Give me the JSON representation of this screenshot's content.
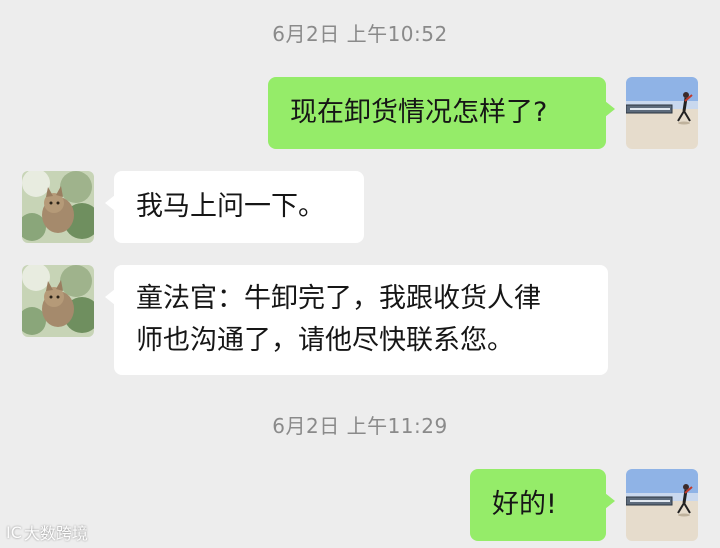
{
  "chat": {
    "timestamps": [
      "6月2日 上午10:52",
      "6月2日 上午11:29"
    ],
    "messages": [
      {
        "direction": "outgoing",
        "text": "现在卸货情况怎样了?"
      },
      {
        "direction": "incoming",
        "text": "我马上问一下。"
      },
      {
        "direction": "incoming",
        "lines": [
          "童法官：牛卸完了，我跟收货人律",
          "师也沟通了，请他尽快联系您。"
        ]
      },
      {
        "direction": "outgoing",
        "text": "好的!"
      }
    ]
  },
  "avatars": {
    "self": {
      "icon": "beach-photo-avatar"
    },
    "contact": {
      "icon": "cat-photo-avatar"
    }
  },
  "watermark": {
    "mark": "IC",
    "text": "大数跨境"
  },
  "colors": {
    "background": "#ededed",
    "outgoing_bubble": "#95ec69",
    "incoming_bubble": "#ffffff",
    "timestamp_text": "#8a8a8a"
  }
}
